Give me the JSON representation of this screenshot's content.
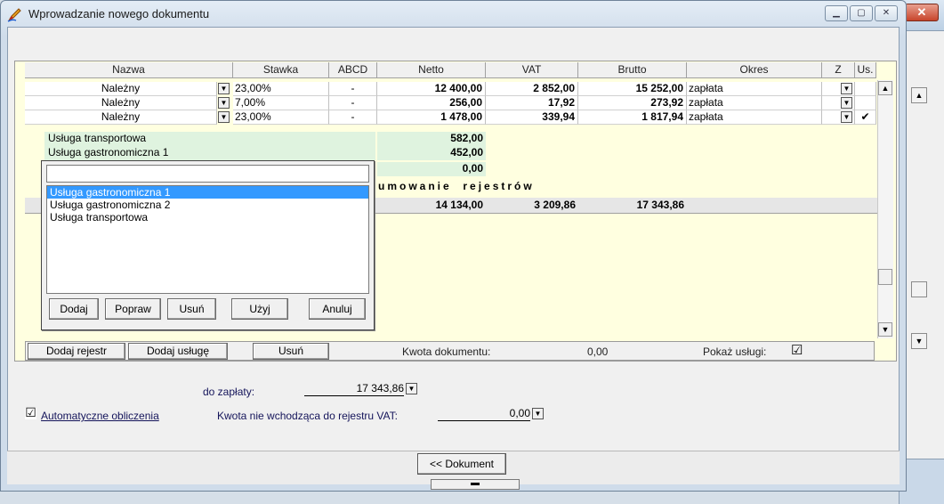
{
  "window": {
    "title": "Wprowadzanie nowego dokumentu"
  },
  "table": {
    "headers": [
      "Nazwa",
      "Stawka",
      "ABCD",
      "Netto",
      "VAT",
      "Brutto",
      "Okres",
      "Z",
      "Us."
    ],
    "rows": [
      {
        "nazwa": "Należny",
        "stawka": "23,00%",
        "abcd": "-",
        "netto": "12 400,00",
        "vat": "2 852,00",
        "brutto": "15 252,00",
        "okres": "zapłata",
        "us": ""
      },
      {
        "nazwa": "Należny",
        "stawka": "7,00%",
        "abcd": "-",
        "netto": "256,00",
        "vat": "17,92",
        "brutto": "273,92",
        "okres": "zapłata",
        "us": ""
      },
      {
        "nazwa": "Należny",
        "stawka": "23,00%",
        "abcd": "-",
        "netto": "1 478,00",
        "vat": "339,94",
        "brutto": "1 817,94",
        "okres": "zapłata",
        "us": "✔"
      }
    ],
    "services": [
      {
        "name": "Usługa transportowa",
        "netto": "582,00"
      },
      {
        "name": "Usługa gastronomiczna 1",
        "netto": "452,00"
      },
      {
        "name": "",
        "netto": "0,00"
      }
    ],
    "summary_label": "umowanie  rejestrów",
    "summary": {
      "netto": "14 134,00",
      "vat": "3 209,86",
      "brutto": "17 343,86"
    }
  },
  "popup": {
    "search_value": "",
    "items": [
      "Usługa gastronomiczna 1",
      "Usługa gastronomiczna 2",
      "Usługa transportowa"
    ],
    "selected_index": 0,
    "buttons": {
      "add": "Dodaj",
      "edit": "Popraw",
      "delete": "Usuń",
      "use": "Użyj",
      "cancel": "Anuluj"
    }
  },
  "toolbar": {
    "add_register": "Dodaj rejestr",
    "add_service": "Dodaj usługę",
    "delete": "Usuń",
    "doc_amount_label": "Kwota dokumentu:",
    "doc_amount_value": "0,00",
    "show_services_label": "Pokaż usługi:",
    "show_services_checked": "☑"
  },
  "footer": {
    "to_pay_label": "do zapłaty:",
    "to_pay_value": "17 343,86",
    "auto_calc_label": "Automatyczne obliczenia",
    "non_vat_label": "Kwota nie wchodząca do rejestru VAT:",
    "non_vat_value": "0,00",
    "document_button": "<< Dokument"
  },
  "icons": {
    "dropdown": "dropdown-arrow-icon",
    "check": "checkmark-icon"
  }
}
